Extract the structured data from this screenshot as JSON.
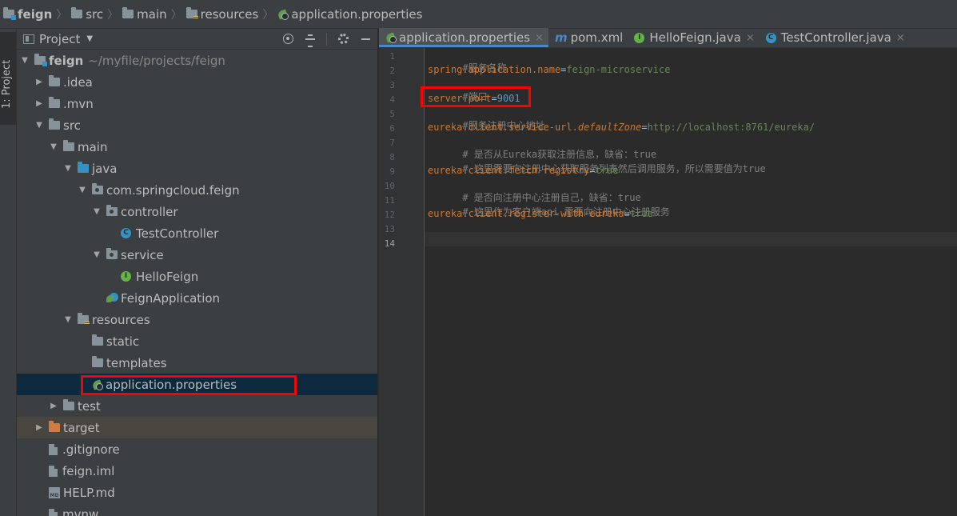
{
  "breadcrumb": [
    "feign",
    "src",
    "main",
    "resources",
    "application.properties"
  ],
  "sidebar_stripe": {
    "label": "1: Project"
  },
  "project_panel": {
    "title": "Project",
    "tree": [
      {
        "name": "feign",
        "path": "~/myfile/projects/feign"
      },
      {
        "name": ".idea"
      },
      {
        "name": ".mvn"
      },
      {
        "name": "src"
      },
      {
        "name": "main"
      },
      {
        "name": "java"
      },
      {
        "name": "com.springcloud.feign"
      },
      {
        "name": "controller"
      },
      {
        "name": "TestController"
      },
      {
        "name": "service"
      },
      {
        "name": "HelloFeign"
      },
      {
        "name": "FeignApplication"
      },
      {
        "name": "resources"
      },
      {
        "name": "static"
      },
      {
        "name": "templates"
      },
      {
        "name": "application.properties"
      },
      {
        "name": "test"
      },
      {
        "name": "target"
      },
      {
        "name": ".gitignore"
      },
      {
        "name": "feign.iml"
      },
      {
        "name": "HELP.md"
      },
      {
        "name": "mvnw"
      }
    ]
  },
  "editor": {
    "tabs": [
      {
        "label": "application.properties",
        "close": "×"
      },
      {
        "label": "pom.xml",
        "icon_letter": "m"
      },
      {
        "label": "HelloFeign.java",
        "close": "×",
        "icon_letter": "I"
      },
      {
        "label": "TestController.java",
        "close": "×",
        "icon_letter": "C"
      }
    ],
    "line_numbers": [
      "1",
      "2",
      "3",
      "4",
      "5",
      "6",
      "7",
      "8",
      "9",
      "10",
      "11",
      "12",
      "13",
      "14"
    ],
    "lines": [
      {
        "comment": "#服务名称"
      },
      {
        "key": "spring.application.name",
        "eq": "=",
        "val": "feign-microservice"
      },
      {
        "comment": "#端口"
      },
      {
        "key": "server.port",
        "eq": "=",
        "num": "9001"
      },
      {
        "comment": "#服务注册中心地址"
      },
      {
        "key_a": "eureka.client.service-url.",
        "key_b": "defaultZone",
        "eq": "=",
        "val": "http://localhost:8761/eureka/"
      },
      {
        "comment": "# 是否从Eureka获取注册信息，缺省：true"
      },
      {
        "comment": "# 这里需要向注册中心获取服务列表然后调用服务，所以需要值为true"
      },
      {
        "key": "eureka.client.fetch-registry",
        "eq": "=",
        "val": "true"
      },
      {
        "comment": "# 是否向注册中心注册自己，缺省：true"
      },
      {
        "comment": "# 这里作为客户端api 需要向注册中心注册服务"
      },
      {
        "key": "eureka.client.register-with-eureka",
        "eq": "=",
        "val": "true"
      }
    ]
  },
  "colors": {
    "highlight_box": "#ff0000",
    "selection": "#0d293e",
    "excluded": "#49463f"
  }
}
